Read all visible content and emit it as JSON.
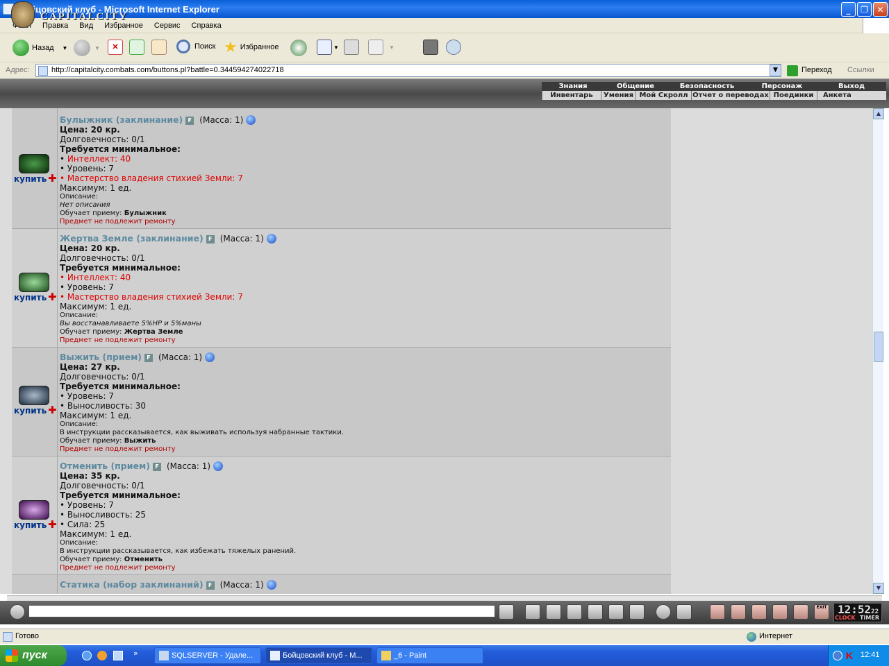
{
  "window": {
    "title": "Бойцовский клуб - Microsoft Internet Explorer"
  },
  "menu": [
    "Файл",
    "Правка",
    "Вид",
    "Избранное",
    "Сервис",
    "Справка"
  ],
  "toolbar": {
    "back": "Назад",
    "search": "Поиск",
    "favorites": "Избранное"
  },
  "address": {
    "label": "Адрес:",
    "url": "http://capitalcity.combats.com/buttons.pl?battle=0.344594274022718",
    "go": "Переход",
    "links": "Ссылки"
  },
  "game": {
    "logo_text": "CAPITALCITY",
    "nav_top": [
      "Знания",
      "Общение",
      "Безопасность",
      "Персонаж",
      "Выход"
    ],
    "nav_bottom": [
      "Инвентарь",
      "Умения",
      "Мой Скролл",
      "Отчет о переводах",
      "Поединки",
      "Анкета"
    ]
  },
  "shop": {
    "buy_label": "купить",
    "f_badge": "F",
    "items": [
      {
        "name": "Булыжник (заклинание)",
        "mass": "(Масса: 1)",
        "price": "Цена: 20 кр.",
        "durability": "Долговечность: 0/1",
        "req_header": "Требуется минимальное:",
        "reqs": [
          "• Интеллект: 40",
          "• Уровень: 7",
          "• Мастерство владения стихией Земли: 7"
        ],
        "max": "Максимум: 1 ед.",
        "desc_label": "Описание:",
        "desc": "Нет описания",
        "teach_label": "Обучает приему:",
        "teach": "Булыжник",
        "repair": "Предмет не подлежит ремонту"
      },
      {
        "name": "Жертва Земле (заклинание)",
        "mass": "(Масса: 1)",
        "price": "Цена: 20 кр.",
        "durability": "Долговечность: 0/1",
        "req_header": "Требуется минимальное:",
        "reqs": [
          "• Интеллект: 40",
          "• Уровень: 7",
          "• Мастерство владения стихией Земли: 7"
        ],
        "max": "Максимум: 1 ед.",
        "desc_label": "Описание:",
        "desc": "Вы восстанавливаете 5%HP и 5%маны",
        "teach_label": "Обучает приему:",
        "teach": "Жертва Земле",
        "repair": "Предмет не подлежит ремонту"
      },
      {
        "name": "Выжить (прием)",
        "mass": "(Масса: 1)",
        "price": "Цена: 27 кр.",
        "durability": "Долговечность: 0/1",
        "req_header": "Требуется минимальное:",
        "reqs": [
          "• Уровень: 7",
          "• Выносливость: 30"
        ],
        "max": "Максимум: 1 ед.",
        "desc_label": "Описание:",
        "desc": "В инструкции рассказывается, как выживать используя набранные тактики.",
        "teach_label": "Обучает приему:",
        "teach": "Выжить",
        "repair": "Предмет не подлежит ремонту"
      },
      {
        "name": "Отменить (прием)",
        "mass": "(Масса: 1)",
        "price": "Цена: 35 кр.",
        "durability": "Долговечность: 0/1",
        "req_header": "Требуется минимальное:",
        "reqs": [
          "• Уровень: 7",
          "• Выносливость: 25",
          "• Сила: 25"
        ],
        "max": "Максимум: 1 ед.",
        "desc_label": "Описание:",
        "desc": "В инструкции рассказывается, как избежать тяжелых ранений.",
        "teach_label": "Обучает приему:",
        "teach": "Отменить",
        "repair": "Предмет не подлежит ремонту"
      },
      {
        "name": "Статика (набор заклинаний)",
        "mass": "(Масса: 1)"
      }
    ]
  },
  "chat": {
    "clock": "12:52",
    "clock_sec": "22",
    "clock_label": "CLOCK",
    "timer_label": "TIMER",
    "exit_label": "EXIT"
  },
  "status": {
    "text": "Готово",
    "zone": "Интернет"
  },
  "taskbar": {
    "start": "пуск",
    "tasks": [
      "SQLSERVER - Удале...",
      "Бойцовский клуб - М...",
      "_6 - Paint"
    ],
    "time": "12:41"
  },
  "colors": {
    "item_name": "#5d8aa0",
    "req_red": "#e00000",
    "buy_blue": "#003388",
    "xp_blue": "#245edb"
  },
  "icons": {
    "back": "back-arrow-icon",
    "forward": "forward-arrow-icon",
    "globe": "globe-icon"
  }
}
